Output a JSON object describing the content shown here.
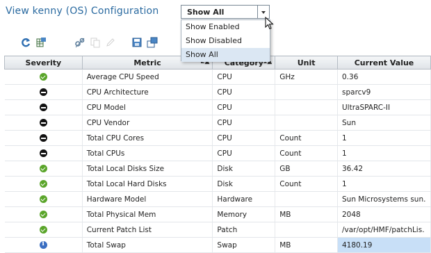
{
  "title": "View kenny (OS) Configuration",
  "filter": {
    "selected": "Show All",
    "options": [
      "Show Enabled",
      "Show Disabled",
      "Show All"
    ]
  },
  "toolbar": {
    "icons": [
      "refresh-icon",
      "export-table-icon",
      "configure-icon",
      "copy-icon",
      "edit-icon",
      "save-icon",
      "open-icon"
    ]
  },
  "table": {
    "columns": [
      "Severity",
      "Metric",
      "Category",
      "Unit",
      "Current Value"
    ],
    "sort": {
      "metric": "2▲",
      "category": "1▲"
    },
    "rows": [
      {
        "severity": "ok",
        "metric": "Average CPU Speed",
        "category": "CPU",
        "unit": "GHz",
        "value": "0.36"
      },
      {
        "severity": "none",
        "metric": "CPU Architecture",
        "category": "CPU",
        "unit": "",
        "value": "sparcv9"
      },
      {
        "severity": "none",
        "metric": "CPU Model",
        "category": "CPU",
        "unit": "",
        "value": "UltraSPARC-II"
      },
      {
        "severity": "none",
        "metric": "CPU Vendor",
        "category": "CPU",
        "unit": "",
        "value": "Sun"
      },
      {
        "severity": "none",
        "metric": "Total CPU Cores",
        "category": "CPU",
        "unit": "Count",
        "value": "1"
      },
      {
        "severity": "none",
        "metric": "Total CPUs",
        "category": "CPU",
        "unit": "Count",
        "value": "1"
      },
      {
        "severity": "ok",
        "metric": "Total Local Disks Size",
        "category": "Disk",
        "unit": "GB",
        "value": "36.42"
      },
      {
        "severity": "ok",
        "metric": "Total Local Hard Disks",
        "category": "Disk",
        "unit": "Count",
        "value": "1"
      },
      {
        "severity": "ok",
        "metric": "Hardware Model",
        "category": "Hardware",
        "unit": "",
        "value": "Sun Microsystems sun."
      },
      {
        "severity": "ok",
        "metric": "Total Physical Mem",
        "category": "Memory",
        "unit": "MB",
        "value": "2048"
      },
      {
        "severity": "ok",
        "metric": "Current Patch List",
        "category": "Patch",
        "unit": "",
        "value": "/var/opt/HMF/patchLis."
      },
      {
        "severity": "info",
        "metric": "Total Swap",
        "category": "Swap",
        "unit": "MB",
        "value": "4180.19"
      }
    ]
  },
  "colors": {
    "title": "#2a6aa0",
    "ok": "#5aa52a",
    "info": "#3b6fc2",
    "highlight": "#c8dff7"
  }
}
